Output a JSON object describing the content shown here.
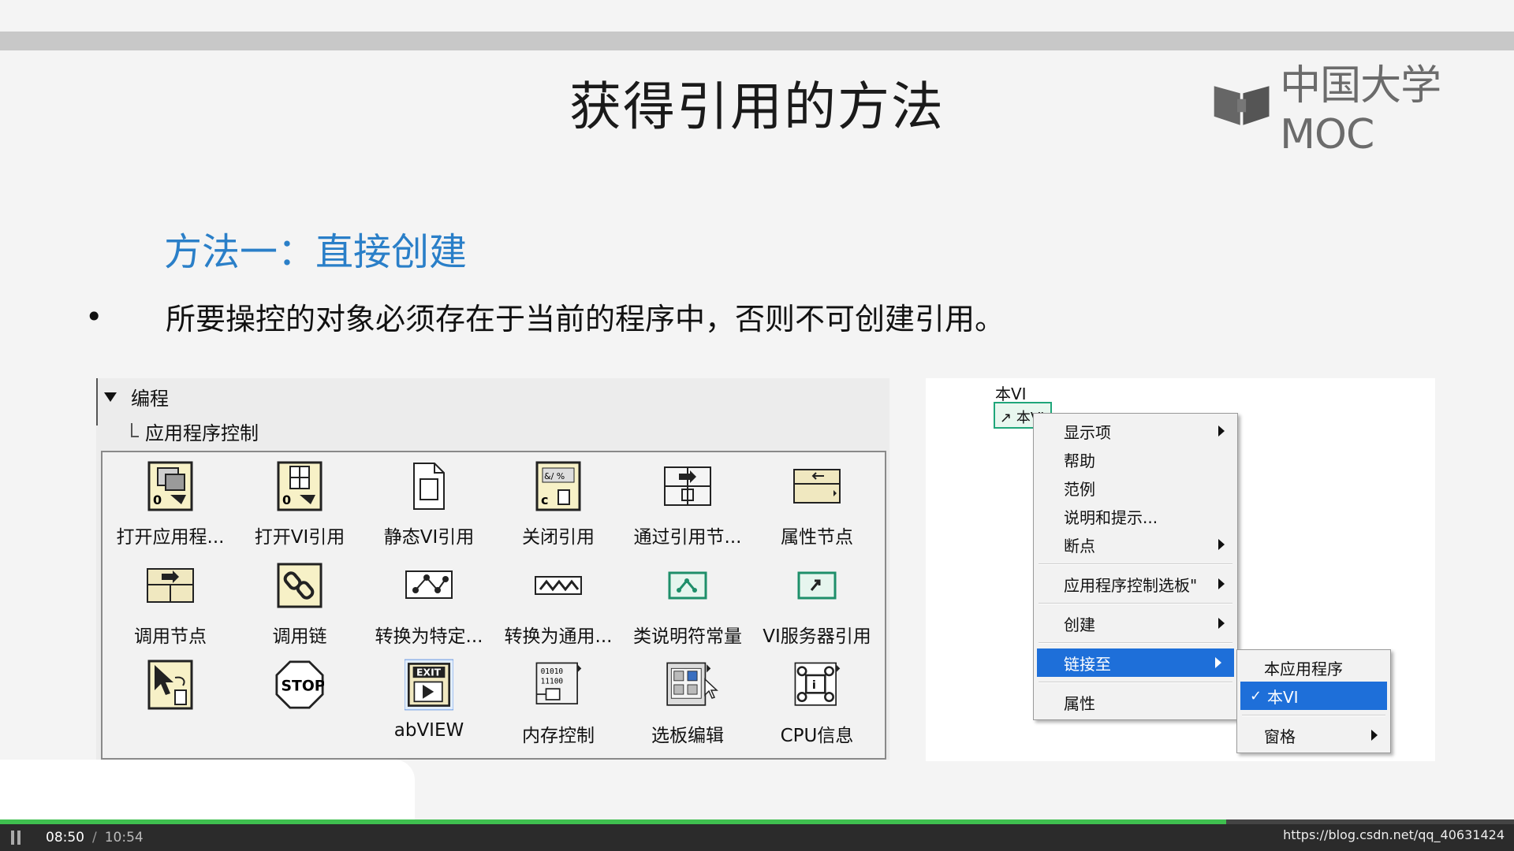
{
  "slide": {
    "title": "获得引用的方法",
    "logo_text": "中国大学MOC",
    "method_heading": "方法一：直接创建",
    "bullet_symbol": "•",
    "bullet_text": "所要操控的对象必须存在于当前的程序中，否则不可创建引用。"
  },
  "palette": {
    "category": "编程",
    "subcategory": "应用程序控制",
    "items": [
      {
        "label": "打开应用程...",
        "icon": "open-app-reference-icon"
      },
      {
        "label": "打开VI引用",
        "icon": "open-vi-reference-icon"
      },
      {
        "label": "静态VI引用",
        "icon": "static-vi-reference-icon"
      },
      {
        "label": "关闭引用",
        "icon": "close-reference-icon"
      },
      {
        "label": "通过引用节...",
        "icon": "call-by-reference-icon"
      },
      {
        "label": "属性节点",
        "icon": "property-node-icon"
      },
      {
        "label": "调用节点",
        "icon": "invoke-node-icon"
      },
      {
        "label": "调用链",
        "icon": "call-chain-icon"
      },
      {
        "label": "转换为特定...",
        "icon": "to-more-specific-icon"
      },
      {
        "label": "转换为通用...",
        "icon": "to-more-generic-icon"
      },
      {
        "label": "类说明符常量",
        "icon": "class-specifier-constant-icon"
      },
      {
        "label": "VI服务器引用",
        "icon": "vi-server-reference-icon"
      },
      {
        "label": "",
        "icon": "select-pointer-icon"
      },
      {
        "label": "",
        "icon": "stop-icon"
      },
      {
        "label": "abVIEW",
        "icon": "exit-labview-icon"
      },
      {
        "label": "内存控制",
        "icon": "memory-control-icon"
      },
      {
        "label": "选板编辑",
        "icon": "palette-editing-icon"
      },
      {
        "label": "CPU信息",
        "icon": "cpu-info-icon"
      }
    ]
  },
  "context_menu": {
    "vi_label": "本VI",
    "vi_constant": "本VI",
    "items": [
      {
        "label": "显示项",
        "submenu": true
      },
      {
        "label": "帮助",
        "submenu": false
      },
      {
        "label": "范例",
        "submenu": false
      },
      {
        "label": "说明和提示...",
        "submenu": false
      },
      {
        "label": "断点",
        "submenu": true
      },
      {
        "label": "应用程序控制选板\"",
        "submenu": true
      },
      {
        "label": "创建",
        "submenu": true
      },
      {
        "label": "链接至",
        "submenu": true
      },
      {
        "label": "属性",
        "submenu": false
      }
    ],
    "submenu": [
      {
        "label": "本应用程序"
      },
      {
        "label": "本VI",
        "checked": "✓"
      },
      {
        "label": "窗格"
      }
    ]
  },
  "player": {
    "current_time": "08:50",
    "separator": "/",
    "total_time": "10:54",
    "progress": 0.81,
    "watermark": "https://blog.csdn.net/qq_40631424"
  },
  "colors": {
    "heading_blue": "#2a7fc8",
    "menu_highlight": "#1e6fd9",
    "progress_green": "#3fbf4f"
  }
}
